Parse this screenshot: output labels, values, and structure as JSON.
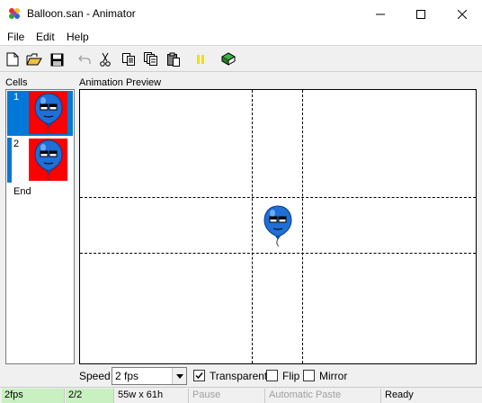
{
  "window": {
    "title": "Balloon.san - Animator"
  },
  "menu": {
    "items": [
      "File",
      "Edit",
      "Help"
    ]
  },
  "toolbar": {
    "buttons": [
      "new-icon",
      "open-icon",
      "save-icon",
      "undo-icon",
      "cut-icon",
      "copy-icon",
      "copy-all-icon",
      "paste-icon",
      "pause-icon",
      "book-icon"
    ]
  },
  "cells": {
    "label": "Cells",
    "items": [
      {
        "number": "1",
        "selected": true
      },
      {
        "number": "2",
        "selected": false
      }
    ],
    "end_label": "End",
    "thumb_color": "#ff0000"
  },
  "preview": {
    "label": "Animation Preview"
  },
  "controls": {
    "speed_label": "Speed",
    "speed_value": "2 fps",
    "transparent_label": "Transparent",
    "transparent_checked": true,
    "flip_label": "Flip",
    "flip_checked": false,
    "mirror_label": "Mirror",
    "mirror_checked": false
  },
  "status": {
    "fps": "2fps",
    "frame": "2/2",
    "size": "55w x 61h",
    "pause": "Pause",
    "auto_paste": "Automatic Paste",
    "state": "Ready"
  },
  "colors": {
    "selection": "#0078d7",
    "balloon": "#1e6fd6",
    "status_green": "#c8f0c0"
  }
}
